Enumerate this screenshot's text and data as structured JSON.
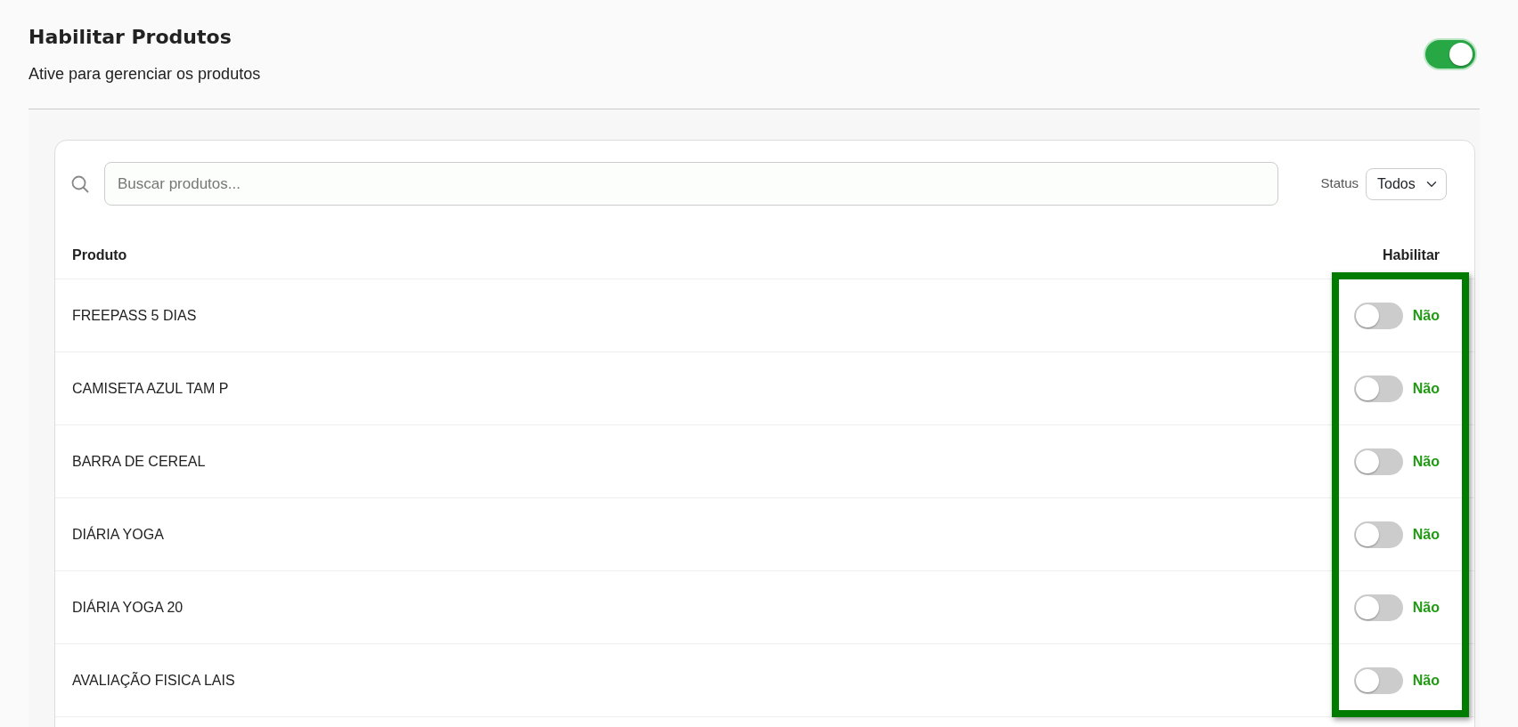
{
  "header": {
    "title": "Habilitar Produtos",
    "subtitle": "Ative para gerenciar os produtos",
    "enabled": true
  },
  "filters": {
    "search": {
      "placeholder": "Buscar produtos..."
    },
    "status": {
      "label": "Status",
      "value": "Todos"
    }
  },
  "table": {
    "columns": [
      "Produto",
      "Habilitar"
    ],
    "column_highlighted": true,
    "rows": [
      {
        "product": "FREEPASS 5 DIAS",
        "enabled": false,
        "state_label": "Não"
      },
      {
        "product": "CAMISETA AZUL TAM P",
        "enabled": false,
        "state_label": "Não"
      },
      {
        "product": "BARRA DE CEREAL",
        "enabled": false,
        "state_label": "Não"
      },
      {
        "product": "DIÁRIA YOGA",
        "enabled": false,
        "state_label": "Não"
      },
      {
        "product": "DIÁRIA YOGA 20",
        "enabled": false,
        "state_label": "Não"
      },
      {
        "product": "AVALIAÇÃO FISICA LAIS",
        "enabled": false,
        "state_label": "Não"
      }
    ]
  }
}
